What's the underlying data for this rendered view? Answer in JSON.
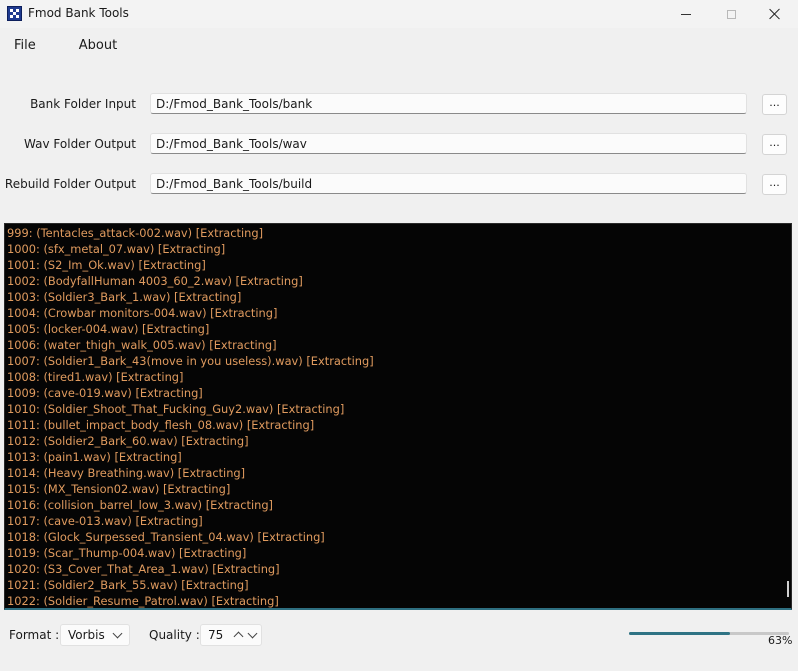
{
  "window": {
    "title": "Fmod Bank Tools"
  },
  "menu": {
    "file": "File",
    "about": "About"
  },
  "paths": [
    {
      "label": "Bank Folder Input",
      "value": "D:/Fmod_Bank_Tools/bank",
      "button": "..."
    },
    {
      "label": "Wav Folder Output",
      "value": "D:/Fmod_Bank_Tools/wav",
      "button": "..."
    },
    {
      "label": "Rebuild Folder Output",
      "value": "D:/Fmod_Bank_Tools/build",
      "button": "..."
    }
  ],
  "log": [
    "999: (Tentacles_attack-002.wav) [Extracting]",
    "1000: (sfx_metal_07.wav) [Extracting]",
    "1001: (S2_Im_Ok.wav) [Extracting]",
    "1002: (BodyfallHuman 4003_60_2.wav) [Extracting]",
    "1003: (Soldier3_Bark_1.wav) [Extracting]",
    "1004: (Crowbar monitors-004.wav) [Extracting]",
    "1005: (locker-004.wav) [Extracting]",
    "1006: (water_thigh_walk_005.wav) [Extracting]",
    "1007: (Soldier1_Bark_43(move in you useless).wav) [Extracting]",
    "1008: (tired1.wav) [Extracting]",
    "1009: (cave-019.wav) [Extracting]",
    "1010: (Soldier_Shoot_That_Fucking_Guy2.wav) [Extracting]",
    "1011: (bullet_impact_body_flesh_08.wav) [Extracting]",
    "1012: (Soldier2_Bark_60.wav) [Extracting]",
    "1013: (pain1.wav) [Extracting]",
    "1014: (Heavy Breathing.wav) [Extracting]",
    "1015: (MX_Tension02.wav) [Extracting]",
    "1016: (collision_barrel_low_3.wav) [Extracting]",
    "1017: (cave-013.wav) [Extracting]",
    "1018: (Glock_Surpessed_Transient_04.wav) [Extracting]",
    "1019: (Scar_Thump-004.wav) [Extracting]",
    "1020: (S3_Cover_That_Area_1.wav) [Extracting]",
    "1021: (Soldier2_Bark_55.wav) [Extracting]",
    "1022: (Soldier_Resume_Patrol.wav) [Extracting]"
  ],
  "bottom": {
    "format_label": "Format :",
    "format_value": "Vorbis",
    "quality_label": "Quality :",
    "quality_value": "75",
    "progress_percent": 63,
    "progress_text": "63%"
  },
  "colors": {
    "log_text": "#e09b5f",
    "log_background": "#050505",
    "accent": "#2f7384"
  },
  "icons": {
    "app": "fmod-app-icon",
    "minimize": "minimize-icon",
    "maximize": "maximize-icon",
    "close": "close-icon",
    "format_dropdown": "chevron-down-icon",
    "quality_spinner": "chevron-up-icon"
  }
}
